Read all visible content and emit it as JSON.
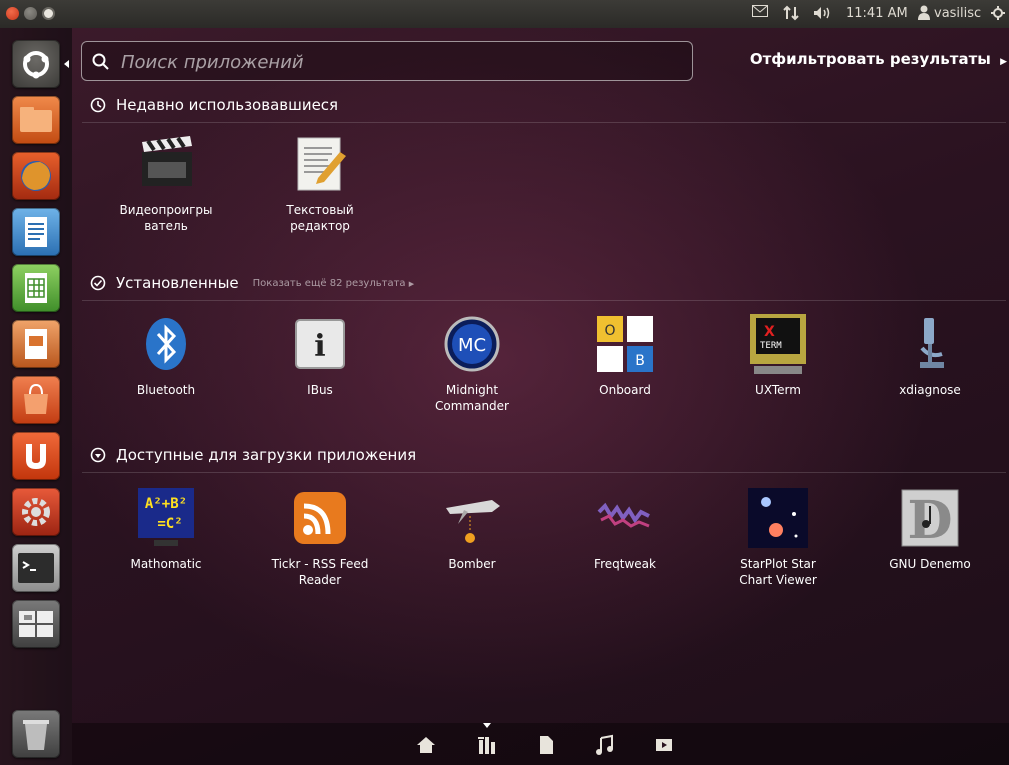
{
  "topbar": {
    "time": "11:41 AM",
    "username": "vasilisc",
    "tray_icons": [
      "mail-icon",
      "network-icon",
      "volume-icon",
      "user-icon",
      "power-icon"
    ]
  },
  "launcher": {
    "items": [
      "ubuntu-logo-icon",
      "home-folder-icon",
      "firefox-icon",
      "writer-icon",
      "calc-icon",
      "impress-icon",
      "software-center-icon",
      "ubuntu-one-icon",
      "system-settings-icon",
      "terminal-icon",
      "workspace-switcher-icon",
      "trash-icon"
    ]
  },
  "search": {
    "placeholder": "Поиск приложений",
    "value": ""
  },
  "filter_label": "Отфильтровать результаты",
  "sections": {
    "recent": {
      "title": "Недавно использовавшиеся",
      "apps": [
        {
          "name": "Видеопроигры\nватель",
          "icon": "clapperboard-icon"
        },
        {
          "name": "Текстовый\nредактор",
          "icon": "text-editor-icon"
        }
      ]
    },
    "installed": {
      "title": "Установленные",
      "more": "Показать ещё 82 результата",
      "apps": [
        {
          "name": "Bluetooth",
          "icon": "bluetooth-icon"
        },
        {
          "name": "IBus",
          "icon": "info-icon"
        },
        {
          "name": "Midnight\nCommander",
          "icon": "mc-icon"
        },
        {
          "name": "Onboard",
          "icon": "keyboard-icon"
        },
        {
          "name": "UXTerm",
          "icon": "xterm-icon"
        },
        {
          "name": "xdiagnose",
          "icon": "microscope-icon"
        }
      ]
    },
    "available": {
      "title": "Доступные для загрузки приложения",
      "apps": [
        {
          "name": "Mathomatic",
          "icon": "math-icon"
        },
        {
          "name": "Tickr - RSS Feed\nReader",
          "icon": "rss-icon"
        },
        {
          "name": "Bomber",
          "icon": "plane-icon"
        },
        {
          "name": "Freqtweak",
          "icon": "freqtweak-icon"
        },
        {
          "name": "StarPlot Star\nChart Viewer",
          "icon": "star-icon"
        },
        {
          "name": "GNU Denemo",
          "icon": "denemo-icon"
        }
      ]
    }
  },
  "lenses": [
    "home-lens-icon",
    "applications-lens-icon",
    "files-lens-icon",
    "music-lens-icon",
    "video-lens-icon"
  ]
}
